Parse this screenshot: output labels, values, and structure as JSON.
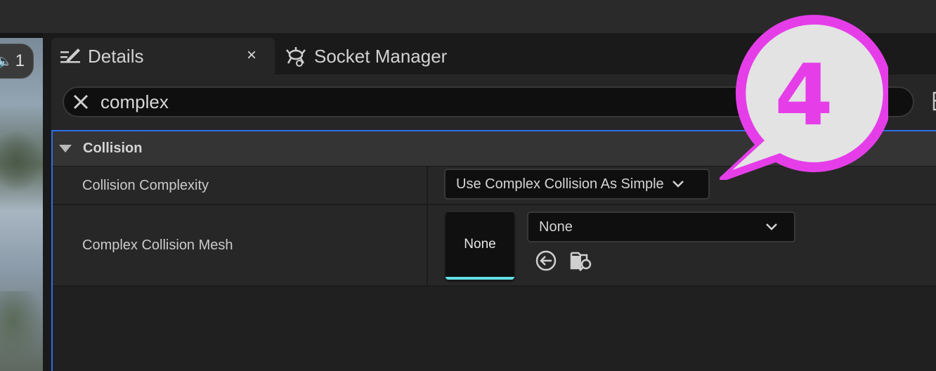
{
  "viewport_badge": {
    "value": "1",
    "icon": "speaker-icon"
  },
  "tabs": [
    {
      "label": "Details",
      "icon": "details-pencil-icon",
      "active": true,
      "close": "×"
    },
    {
      "label": "Socket Manager",
      "icon": "socket-manager-icon",
      "active": false
    }
  ],
  "search": {
    "value": "complex",
    "clear_icon": "close-icon"
  },
  "category": {
    "label": "Collision",
    "expanded": true
  },
  "properties": [
    {
      "name": "Collision Complexity",
      "value": "Use Complex Collision As Simple"
    },
    {
      "name": "Complex Collision Mesh",
      "thumbnail_label": "None",
      "value": "None",
      "buttons": [
        "use-selected-icon",
        "browse-icon"
      ]
    }
  ],
  "callout": {
    "number": "4",
    "color": "#e53ee9"
  },
  "colors": {
    "selection_border": "#2f6ee8",
    "thumbnail_accent": "#63dfe6"
  }
}
